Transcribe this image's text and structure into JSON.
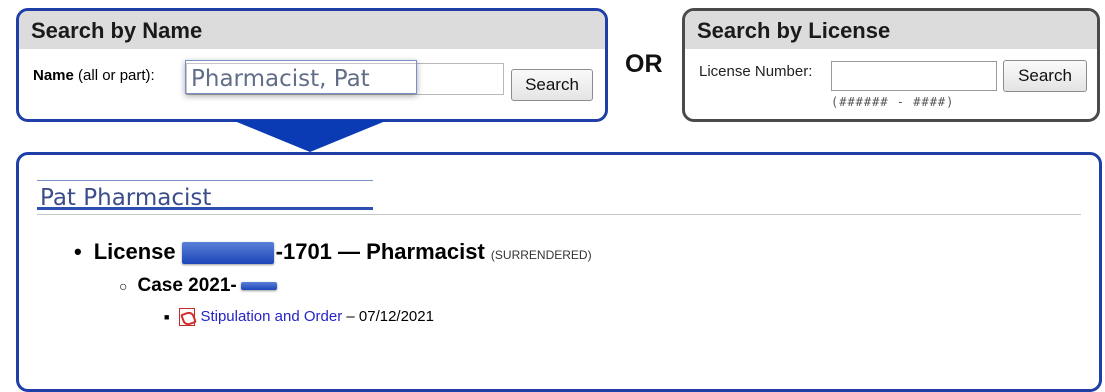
{
  "name_search": {
    "title": "Search by Name",
    "label_bold": "Name",
    "label_hint": "(all or part):",
    "input_value": "Pharmacist, Pat",
    "button": "Search"
  },
  "or_label": "OR",
  "license_search": {
    "title": "Search by License",
    "label": "License Number:",
    "input_value": "",
    "format_hint": "(###### - ####)",
    "button": "Search"
  },
  "result": {
    "name": "Pat Pharmacist",
    "license": {
      "prefix": "License",
      "number_suffix": "-1701",
      "separator": " — ",
      "profession": "Pharmacist",
      "status": "(SURRENDERED)"
    },
    "case": {
      "prefix": "Case 2021-"
    },
    "document": {
      "title": "Stipulation and Order",
      "separator": " – ",
      "date": "07/12/2021"
    }
  },
  "colors": {
    "panel_border_blue": "#1e3fa8",
    "panel_border_gray": "#4a4a4a",
    "header_bg": "#dcdcdc",
    "redaction": "#1d46b8",
    "link": "#2323c8"
  }
}
